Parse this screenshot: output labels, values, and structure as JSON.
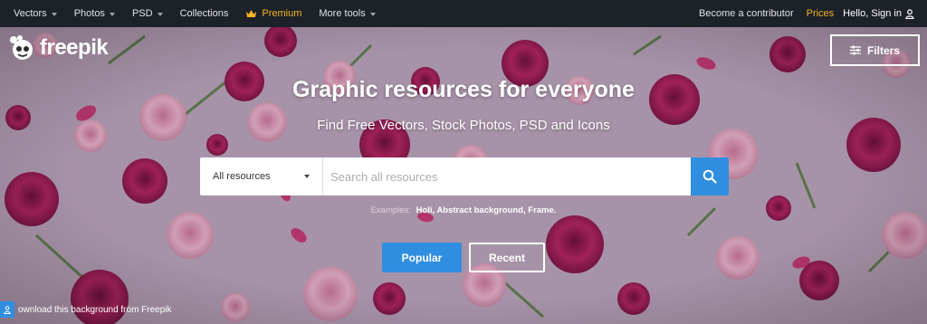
{
  "nav": {
    "items": [
      {
        "label": "Vectors",
        "has_caret": true
      },
      {
        "label": "Photos",
        "has_caret": true
      },
      {
        "label": "PSD",
        "has_caret": true
      },
      {
        "label": "Collections",
        "has_caret": false
      },
      {
        "label": "Premium",
        "has_caret": false
      },
      {
        "label": "More tools",
        "has_caret": true
      }
    ],
    "contributor": "Become a contributor",
    "prices": "Prices",
    "signin": "Hello, Sign in",
    "premium_color": "#f5b324"
  },
  "logo": {
    "text": "freepik"
  },
  "filters": {
    "label": "Filters"
  },
  "hero": {
    "headline": "Graphic resources for everyone",
    "subline": "Find Free Vectors, Stock Photos, PSD and Icons"
  },
  "search": {
    "category": "All resources",
    "placeholder": "Search all resources",
    "button_color": "#2f8ee0"
  },
  "examples": {
    "label": "Examples:",
    "values": "Holi, Abstract background, Frame."
  },
  "buttons": {
    "popular": "Popular",
    "recent": "Recent"
  },
  "credit": {
    "text": "ownload this background from Freepik"
  },
  "icons": [
    "chevron-down-icon",
    "crown-icon",
    "user-icon",
    "freepik-logo-icon",
    "filters-icon",
    "search-icon"
  ]
}
